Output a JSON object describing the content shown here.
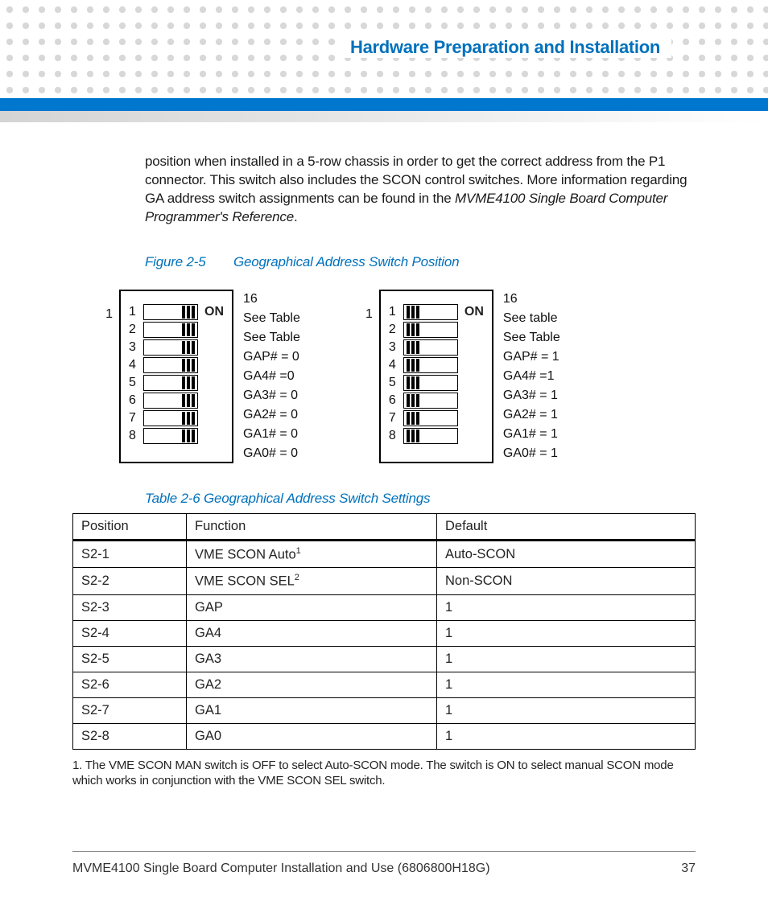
{
  "header": {
    "title": "Hardware Preparation and Installation"
  },
  "paragraph": {
    "line1": "position when installed in a 5-row chassis in order to get the correct address from the P1 connector. This switch also includes the SCON control switches. More information regarding GA address switch assignments can be found in the ",
    "italic1": "MVME4100 Single Board Computer Programmer's Reference",
    "tail": "."
  },
  "figure": {
    "num": "Figure 2-5",
    "title": "Geographical Address Switch Position"
  },
  "diagram_left": {
    "lead": "1",
    "top16": "16",
    "on": "ON",
    "positions": [
      "1",
      "2",
      "3",
      "4",
      "5",
      "6",
      "7",
      "8"
    ],
    "signals": [
      "See Table",
      "See Table",
      "GAP# = 0",
      "GA4# =0",
      "GA3# = 0",
      "GA2# = 0",
      "GA1# = 0",
      "GA0# = 0"
    ],
    "side": "right"
  },
  "diagram_right": {
    "lead": "1",
    "top16": "16",
    "on": "ON",
    "positions": [
      "1",
      "2",
      "3",
      "4",
      "5",
      "6",
      "7",
      "8"
    ],
    "signals": [
      "See table",
      "See Table",
      "GAP# = 1",
      "GA4# =1",
      "GA3# = 1",
      "GA2# = 1",
      "GA1# = 1",
      "GA0# = 1"
    ],
    "side": "left"
  },
  "table_caption": "Table 2-6 Geographical Address Switch Settings",
  "table": {
    "headers": [
      "Position",
      "Function",
      "Default"
    ],
    "rows": [
      {
        "pos": "S2-1",
        "func": "VME SCON Auto",
        "sup": "1",
        "def": "Auto-SCON"
      },
      {
        "pos": "S2-2",
        "func": "VME SCON SEL",
        "sup": "2",
        "def": "Non-SCON"
      },
      {
        "pos": "S2-3",
        "func": "GAP",
        "sup": "",
        "def": "1"
      },
      {
        "pos": "S2-4",
        "func": "GA4",
        "sup": "",
        "def": "1"
      },
      {
        "pos": "S2-5",
        "func": "GA3",
        "sup": "",
        "def": "1"
      },
      {
        "pos": "S2-6",
        "func": "GA2",
        "sup": "",
        "def": "1"
      },
      {
        "pos": "S2-7",
        "func": "GA1",
        "sup": "",
        "def": "1"
      },
      {
        "pos": "S2-8",
        "func": "GA0",
        "sup": "",
        "def": "1"
      }
    ]
  },
  "footnote": "1. The VME SCON MAN switch is OFF to select Auto-SCON mode. The switch is ON to select manual SCON mode which works in conjunction with the VME SCON SEL switch.",
  "footer": {
    "doc": "MVME4100 Single Board Computer Installation and Use (6806800H18G)",
    "page": "37"
  }
}
